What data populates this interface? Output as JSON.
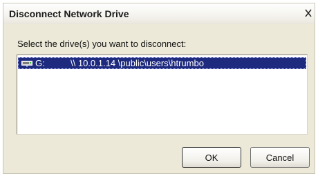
{
  "window": {
    "title": "Disconnect Network Drive",
    "close_glyph": "X"
  },
  "prompt": "Select the drive(s) you want to disconnect:",
  "drives": [
    {
      "letter": "G:",
      "path": "\\\\ 10.0.1.14 \\public\\users\\htrumbo",
      "icon": "network-drive-icon",
      "selected": true
    }
  ],
  "buttons": {
    "ok": "OK",
    "cancel": "Cancel"
  },
  "colors": {
    "selection": "#1d2a7e",
    "dialog_bg": "#ece9d8"
  }
}
